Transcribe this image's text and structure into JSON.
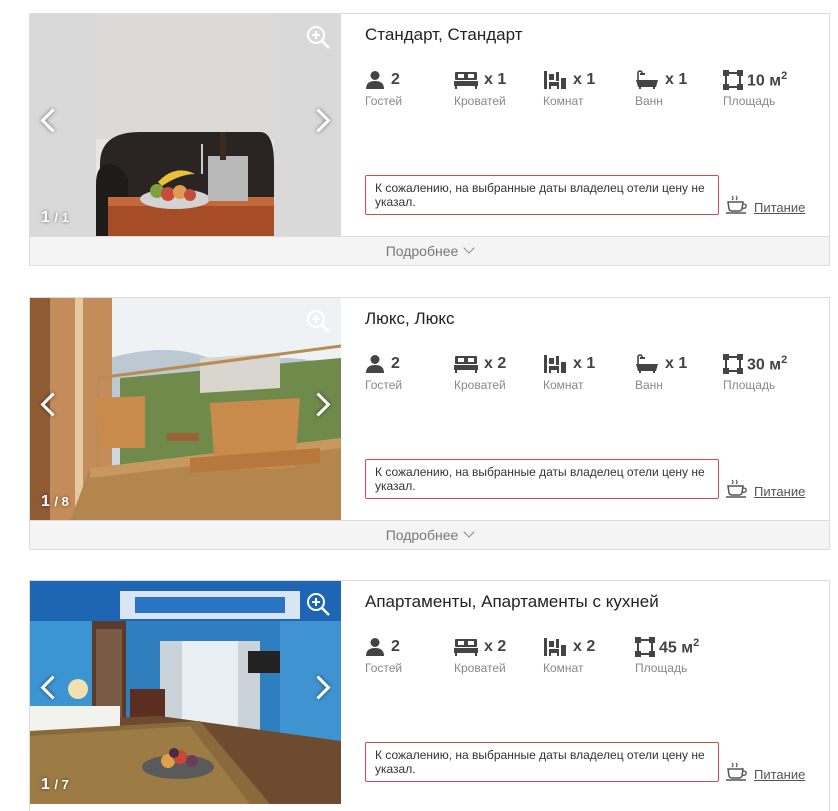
{
  "rooms": [
    {
      "title": "Стандарт, Стандарт",
      "counter_current": "1",
      "counter_total": "/ 1",
      "features": [
        {
          "icon": "guests-icon",
          "value": "2",
          "label": "Гостей"
        },
        {
          "icon": "bed-icon",
          "value": "x 1",
          "label": "Кроватей"
        },
        {
          "icon": "room-icon",
          "value": "x 1",
          "label": "Комнат"
        },
        {
          "icon": "bath-icon",
          "value": "x 1",
          "label": "Ванн"
        },
        {
          "icon": "area-icon",
          "value": "10 м",
          "sup": "2",
          "label": "Площадь"
        }
      ],
      "notice": "К сожалению, на выбранные даты владелец отели цену не указал.",
      "meal_label": "Питание",
      "more_label": "Подробнее"
    },
    {
      "title": "Люкс, Люкс",
      "counter_current": "1",
      "counter_total": "/ 8",
      "features": [
        {
          "icon": "guests-icon",
          "value": "2",
          "label": "Гостей"
        },
        {
          "icon": "bed-icon",
          "value": "x 2",
          "label": "Кроватей"
        },
        {
          "icon": "room-icon",
          "value": "x 1",
          "label": "Комнат"
        },
        {
          "icon": "bath-icon",
          "value": "x 1",
          "label": "Ванн"
        },
        {
          "icon": "area-icon",
          "value": "30 м",
          "sup": "2",
          "label": "Площадь"
        }
      ],
      "notice": "К сожалению, на выбранные даты владелец отели цену не указал.",
      "meal_label": "Питание",
      "more_label": "Подробнее"
    },
    {
      "title": "Апартаменты, Апартаменты с кухней",
      "counter_current": "1",
      "counter_total": "/ 7",
      "features": [
        {
          "icon": "guests-icon",
          "value": "2",
          "label": "Гостей"
        },
        {
          "icon": "bed-icon",
          "value": "x 2",
          "label": "Кроватей"
        },
        {
          "icon": "room-icon",
          "value": "x 2",
          "label": "Комнат"
        },
        {
          "icon": "area-icon",
          "value": "45 м",
          "sup": "2",
          "label": "Площадь"
        }
      ],
      "notice": "К сожалению, на выбранные даты владелец отели цену не указал.",
      "meal_label": "Питание"
    }
  ],
  "colors": {
    "notice_border": "#d24a4a",
    "icon": "#444444",
    "label": "#888888"
  }
}
